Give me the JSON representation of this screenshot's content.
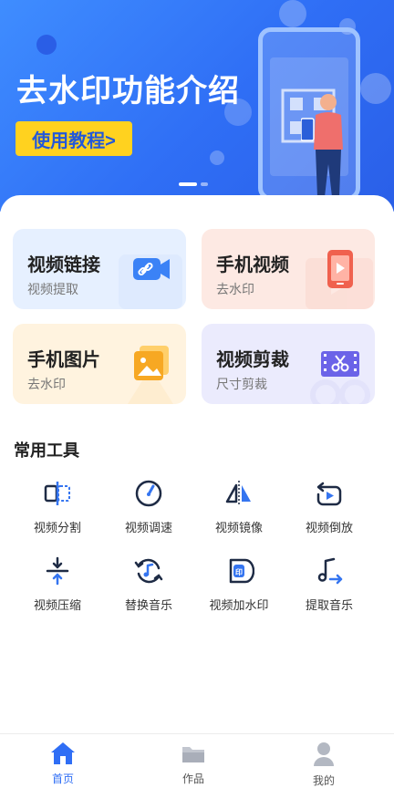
{
  "banner": {
    "title": "去水印功能介绍",
    "button_label": "使用教程>"
  },
  "cards": [
    {
      "title": "视频链接",
      "subtitle": "视频提取",
      "icon": "video-link-icon"
    },
    {
      "title": "手机视频",
      "subtitle": "去水印",
      "icon": "phone-video-icon"
    },
    {
      "title": "手机图片",
      "subtitle": "去水印",
      "icon": "phone-image-icon"
    },
    {
      "title": "视频剪裁",
      "subtitle": "尺寸剪裁",
      "icon": "video-crop-icon"
    }
  ],
  "tools_section": {
    "title": "常用工具",
    "items": [
      {
        "label": "视频分割",
        "icon": "split-icon"
      },
      {
        "label": "视频调速",
        "icon": "speed-icon"
      },
      {
        "label": "视频镜像",
        "icon": "mirror-icon"
      },
      {
        "label": "视频倒放",
        "icon": "reverse-icon"
      },
      {
        "label": "视频压缩",
        "icon": "compress-icon"
      },
      {
        "label": "替换音乐",
        "icon": "replace-music-icon"
      },
      {
        "label": "视频加水印",
        "icon": "add-watermark-icon"
      },
      {
        "label": "提取音乐",
        "icon": "extract-music-icon"
      }
    ]
  },
  "nav": {
    "items": [
      {
        "label": "首页",
        "icon": "home-icon",
        "active": true
      },
      {
        "label": "作品",
        "icon": "folder-icon",
        "active": false
      },
      {
        "label": "我的",
        "icon": "profile-icon",
        "active": false
      }
    ]
  },
  "colors": {
    "accent": "#2f6ef5",
    "banner_button": "#ffd21f",
    "tool_blue": "#3575f0",
    "tool_dark": "#1e2b45"
  }
}
